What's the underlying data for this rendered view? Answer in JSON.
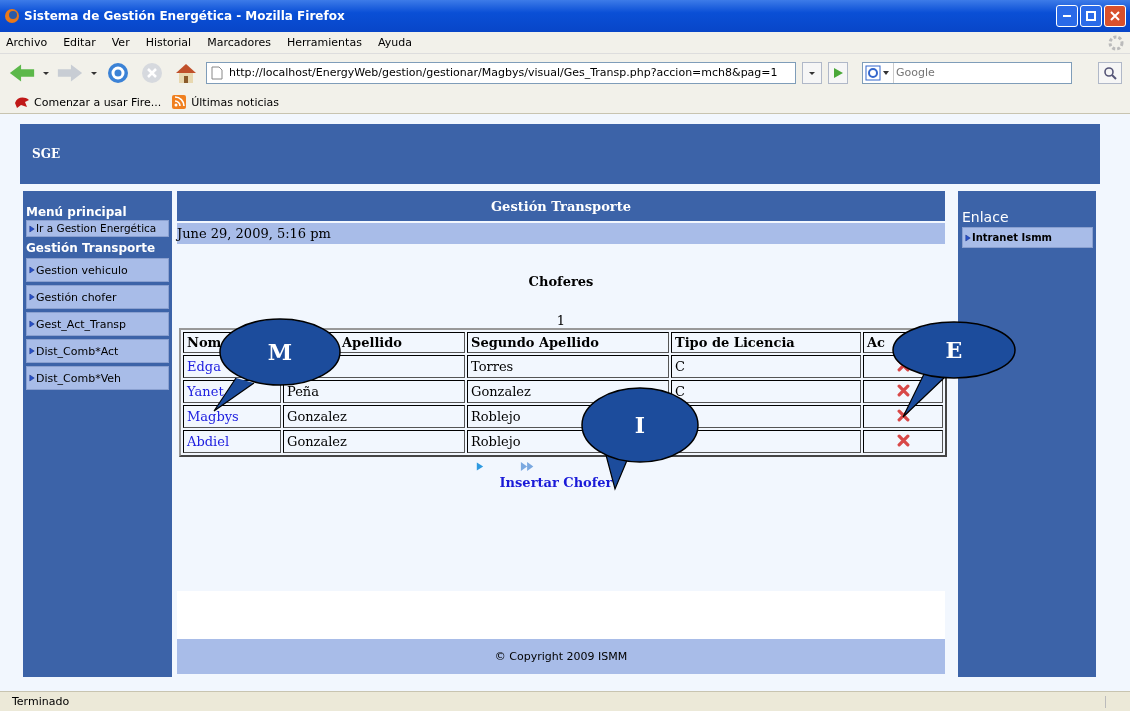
{
  "window": {
    "title": "Sistema de Gestión Energética - Mozilla Firefox"
  },
  "menu_bar": [
    "Archivo",
    "Editar",
    "Ver",
    "Historial",
    "Marcadores",
    "Herramientas",
    "Ayuda"
  ],
  "address_bar": {
    "value": "http://localhost/EnergyWeb/gestion/gestionar/Magbys/visual/Ges_Transp.php?accion=mch8&pag=1"
  },
  "search": {
    "placeholder": "Google"
  },
  "bookmarks": [
    "Comenzar a usar Fire...",
    "Últimas noticias"
  ],
  "site": {
    "logo": "SGE"
  },
  "left_menu": {
    "title": "Menú principal",
    "items": [
      {
        "label": "Ir a Gestion Energética"
      }
    ],
    "section": "Gestión Transporte",
    "section_items": [
      {
        "label": "Gestion vehiculo"
      },
      {
        "label": "Gestión chofer"
      },
      {
        "label": "Gest_Act_Transp"
      },
      {
        "label": "Dist_Comb*Act"
      },
      {
        "label": "Dist_Comb*Veh"
      }
    ]
  },
  "content": {
    "title": "Gestión Transporte",
    "date": "June 29, 2009, 5:16 pm",
    "heading": "Choferes",
    "page_number": "1",
    "table": {
      "columns": [
        "Nom",
        "Apellido",
        "Segundo Apellido",
        "Tipo de Licencia",
        "Ac"
      ],
      "rows": [
        {
          "cells": [
            "Edga",
            "",
            "Torres",
            "C",
            ""
          ]
        },
        {
          "cells": [
            "Yanet",
            "Peña",
            "Gonzalez",
            "C",
            ""
          ]
        },
        {
          "cells": [
            "Magbys",
            "Gonzalez",
            "Roblejo",
            "",
            ""
          ]
        },
        {
          "cells": [
            "Abdiel",
            "Gonzalez",
            "Roblejo",
            "",
            ""
          ]
        }
      ]
    },
    "insert_link": "Insertar Chofer",
    "footer": "© Copyright 2009 ISMM"
  },
  "right_menu": {
    "title": "Enlace",
    "items": [
      {
        "label": "Intranet Ismm"
      }
    ]
  },
  "callouts": [
    "M",
    "I",
    "E"
  ],
  "status_bar": "Terminado"
}
